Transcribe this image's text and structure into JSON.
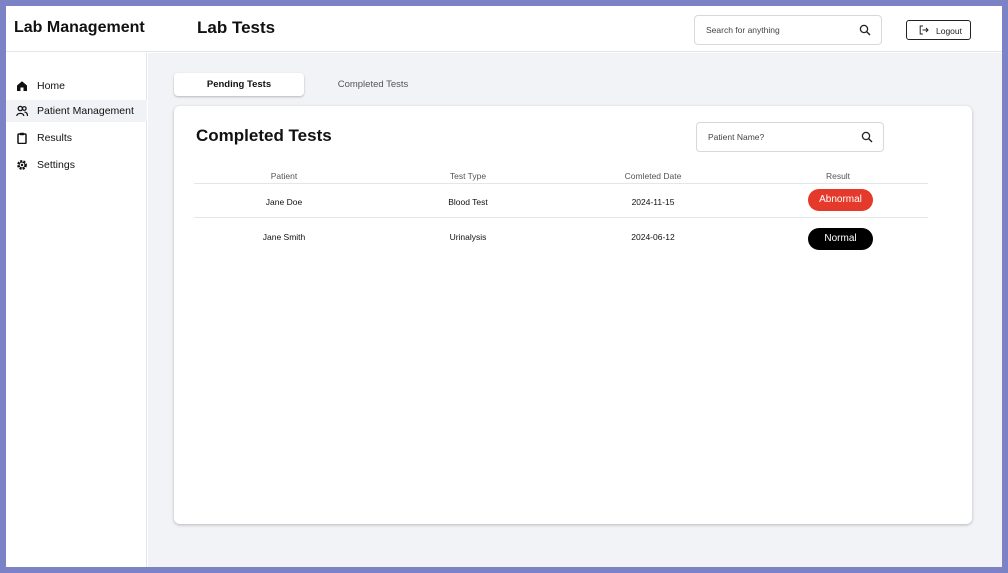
{
  "header": {
    "brand": "Lab Management",
    "page_title": "Lab Tests",
    "search_placeholder": "Search for anything",
    "logout_label": "Logout"
  },
  "sidebar": {
    "items": [
      {
        "label": "Home",
        "icon": "home-icon"
      },
      {
        "label": "Patient Management",
        "icon": "users-icon",
        "active": true
      },
      {
        "label": "Results",
        "icon": "clipboard-icon"
      },
      {
        "label": "Settings",
        "icon": "gear-icon"
      }
    ]
  },
  "tabs": [
    {
      "label": "Pending Tests",
      "active": true
    },
    {
      "label": "Completed Tests",
      "active": false
    }
  ],
  "card": {
    "title": "Completed Tests",
    "search_placeholder": "Patient Name?",
    "columns": [
      "Patient",
      "Test Type",
      "Comleted Date",
      "Result"
    ],
    "rows": [
      {
        "patient": "Jane Doe",
        "test_type": "Blood Test",
        "date": "2024-11-15",
        "result": "Abnormal",
        "result_color": "#e53a2b"
      },
      {
        "patient": "Jane Smith",
        "test_type": "Urinalysis",
        "date": "2024-06-12",
        "result": "Normal",
        "result_color": "#000000"
      }
    ]
  },
  "colors": {
    "frame": "#7b83c6",
    "main_bg": "#f2f3f6",
    "abnormal": "#e53a2b",
    "normal": "#000000"
  }
}
